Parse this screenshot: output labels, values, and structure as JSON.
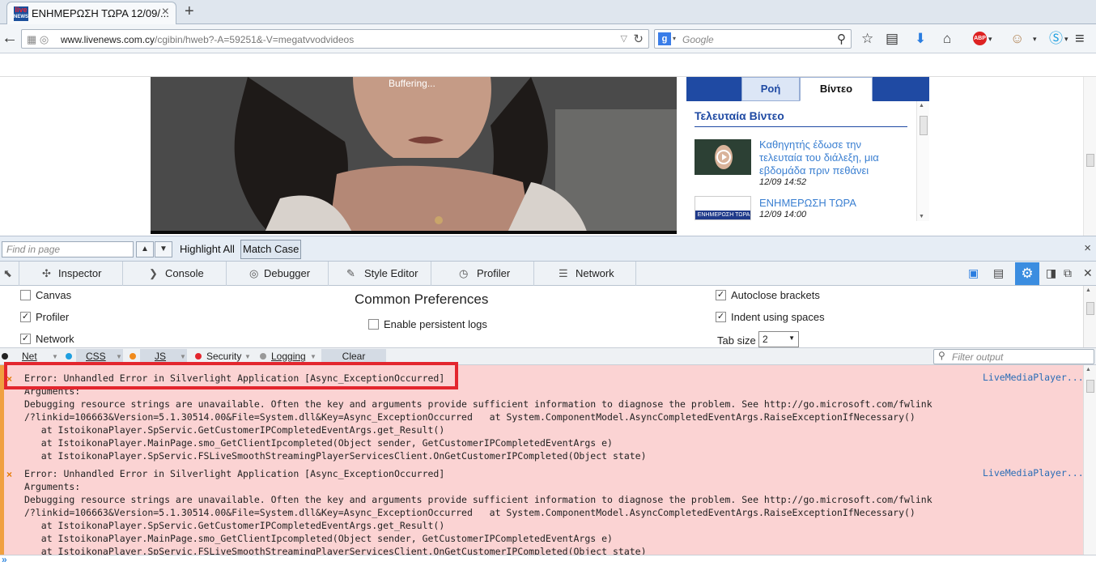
{
  "browser": {
    "tab": {
      "favicon_top": "live",
      "favicon_bottom": "NEWS",
      "title": "ΕΝΗΜΕΡΩΣΗ ΤΩΡΑ 12/09/...",
      "close": "×"
    },
    "new_tab": "+",
    "url": {
      "domain": "www.livenews.com.cy",
      "path": "/cgibin/hweb?-A=59251&-V=megatvvodvideos"
    },
    "search": {
      "engine": "g",
      "placeholder": "Google"
    }
  },
  "page": {
    "video": {
      "status": "Buffering..."
    },
    "sidebar": {
      "tabs": [
        "Ροή",
        "Βίντεο"
      ],
      "active_tab": "Βίντεο",
      "section_title": "Τελευταία Βίντεο",
      "items": [
        {
          "title": "Καθηγητής έδωσε την τελευταία του διάλεξη, μια εβδομάδα πριν πεθάνει",
          "date": "12/09 14:52"
        },
        {
          "title": "ΕΝΗΜΕΡΩΣΗ ΤΩΡΑ",
          "date": "12/09 14:00",
          "thumb_label": "ΕΝΗΜΕΡΩΣΗ ΤΩΡΑ"
        }
      ]
    }
  },
  "findbar": {
    "placeholder": "Find in page",
    "highlight_all": "Highlight All",
    "match_case": "Match Case",
    "close": "×"
  },
  "devtools": {
    "tabs": [
      "Inspector",
      "Console",
      "Debugger",
      "Style Editor",
      "Profiler",
      "Network"
    ],
    "options": {
      "left": [
        {
          "label": "Canvas",
          "checked": false
        },
        {
          "label": "Profiler",
          "checked": true
        },
        {
          "label": "Network",
          "checked": true
        }
      ],
      "center_title": "Common Preferences",
      "center": [
        {
          "label": "Enable persistent logs",
          "checked": false
        }
      ],
      "right": [
        {
          "label": "Autoclose brackets",
          "checked": true
        },
        {
          "label": "Indent using spaces",
          "checked": true
        }
      ],
      "tab_size_label": "Tab size",
      "tab_size_value": "2"
    },
    "console_filter": {
      "net": "Net",
      "css": "CSS",
      "js": "JS",
      "security": "Security",
      "logging": "Logging",
      "clear": "Clear",
      "filter_placeholder": "Filter output",
      "colors": {
        "net": "#222222",
        "css": "#1e9fe0",
        "js": "#f08a1c",
        "security": "#e3262e",
        "logging": "#999999"
      }
    },
    "messages": [
      {
        "location": "LiveMediaPlayer...",
        "lines": [
          "Error: Unhandled Error in Silverlight Application [Async_ExceptionOccurred]",
          "Arguments:",
          "Debugging resource strings are unavailable. Often the key and arguments provide sufficient information to diagnose the problem. See http://go.microsoft.com/fwlink",
          "/?linkid=106663&Version=5.1.30514.00&File=System.dll&Key=Async_ExceptionOccurred   at System.ComponentModel.AsyncCompletedEventArgs.RaiseExceptionIfNecessary()",
          "   at IstoikonaPlayer.SpServic.GetCustomerIPCompletedEventArgs.get_Result()",
          "   at IstoikonaPlayer.MainPage.smo_GetClientIpcompleted(Object sender, GetCustomerIPCompletedEventArgs e)",
          "   at IstoikonaPlayer.SpServic.FSLiveSmoothStreamingPlayerServicesClient.OnGetCustomerIPCompleted(Object state)"
        ]
      },
      {
        "location": "LiveMediaPlayer...",
        "lines": [
          "Error: Unhandled Error in Silverlight Application [Async_ExceptionOccurred]",
          "Arguments:",
          "Debugging resource strings are unavailable. Often the key and arguments provide sufficient information to diagnose the problem. See http://go.microsoft.com/fwlink",
          "/?linkid=106663&Version=5.1.30514.00&File=System.dll&Key=Async_ExceptionOccurred   at System.ComponentModel.AsyncCompletedEventArgs.RaiseExceptionIfNecessary()",
          "   at IstoikonaPlayer.SpServic.GetCustomerIPCompletedEventArgs.get_Result()",
          "   at IstoikonaPlayer.MainPage.smo_GetClientIpcompleted(Object sender, GetCustomerIPCompletedEventArgs e)",
          "   at IstoikonaPlayer.SpServic.FSLiveSmoothStreamingPlayerServicesClient.OnGetCustomerIPCompleted(Object state)"
        ]
      }
    ],
    "prompt": "»"
  },
  "colors": {
    "error_bg": "#fbd3d3",
    "accent_blue": "#1f4aa3",
    "highlight_red": "#e3262e",
    "settings_blue": "#3b8de0"
  }
}
